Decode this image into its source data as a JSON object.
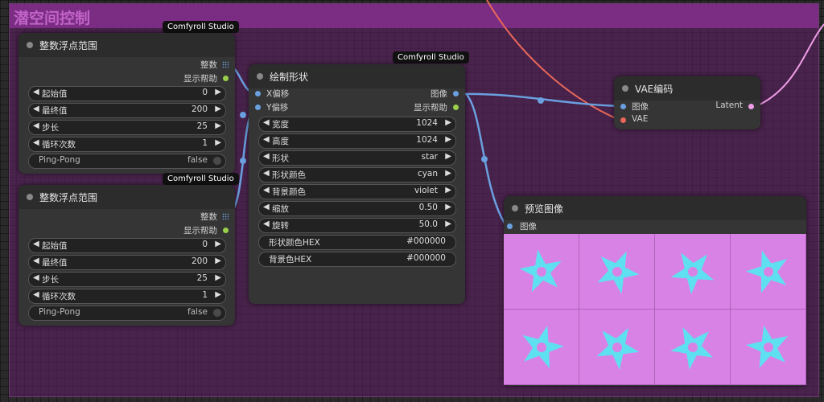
{
  "group": {
    "title": "潜空间控制"
  },
  "badges": [
    "Comfyroll Studio",
    "Comfyroll Studio",
    "Comfyroll Studio"
  ],
  "range_node_1": {
    "title": "整数浮点范围",
    "outputs": [
      "整数",
      "显示帮助"
    ],
    "widgets": [
      {
        "label": "起始值",
        "value": "0"
      },
      {
        "label": "最终值",
        "value": "200"
      },
      {
        "label": "步长",
        "value": "25"
      },
      {
        "label": "循环次数",
        "value": "1"
      }
    ],
    "toggle": {
      "label": "Ping-Pong",
      "value": "false"
    }
  },
  "range_node_2": {
    "title": "整数浮点范围",
    "outputs": [
      "整数",
      "显示帮助"
    ],
    "widgets": [
      {
        "label": "起始值",
        "value": "0"
      },
      {
        "label": "最终值",
        "value": "200"
      },
      {
        "label": "步长",
        "value": "25"
      },
      {
        "label": "循环次数",
        "value": "1"
      }
    ],
    "toggle": {
      "label": "Ping-Pong",
      "value": "false"
    }
  },
  "draw_shape_node": {
    "title": "绘制形状",
    "inputs": [
      "X偏移",
      "Y偏移"
    ],
    "outputs": [
      "图像",
      "显示帮助"
    ],
    "widgets": [
      {
        "label": "宽度",
        "value": "1024"
      },
      {
        "label": "高度",
        "value": "1024"
      },
      {
        "label": "形状",
        "value": "star"
      },
      {
        "label": "形状颜色",
        "value": "cyan"
      },
      {
        "label": "背景颜色",
        "value": "violet"
      },
      {
        "label": "缩放",
        "value": "0.50"
      },
      {
        "label": "旋转",
        "value": "50.0"
      }
    ],
    "text_widgets": [
      {
        "label": "形状颜色HEX",
        "value": "#000000"
      },
      {
        "label": "背景色HEX",
        "value": "#000000"
      }
    ]
  },
  "vae_node": {
    "title": "VAE编码",
    "inputs": [
      "图像",
      "VAE"
    ],
    "outputs": [
      "Latent"
    ]
  },
  "preview_node": {
    "title": "预览图像",
    "inputs": [
      "图像"
    ]
  },
  "colors": {
    "image_socket": "#6aa0e0",
    "vae_socket": "#e8675a",
    "help_socket": "#9bd04a",
    "latent_socket": "#f09ee8",
    "preview_bg": "#d982e6",
    "star": "#5fe0f0"
  }
}
